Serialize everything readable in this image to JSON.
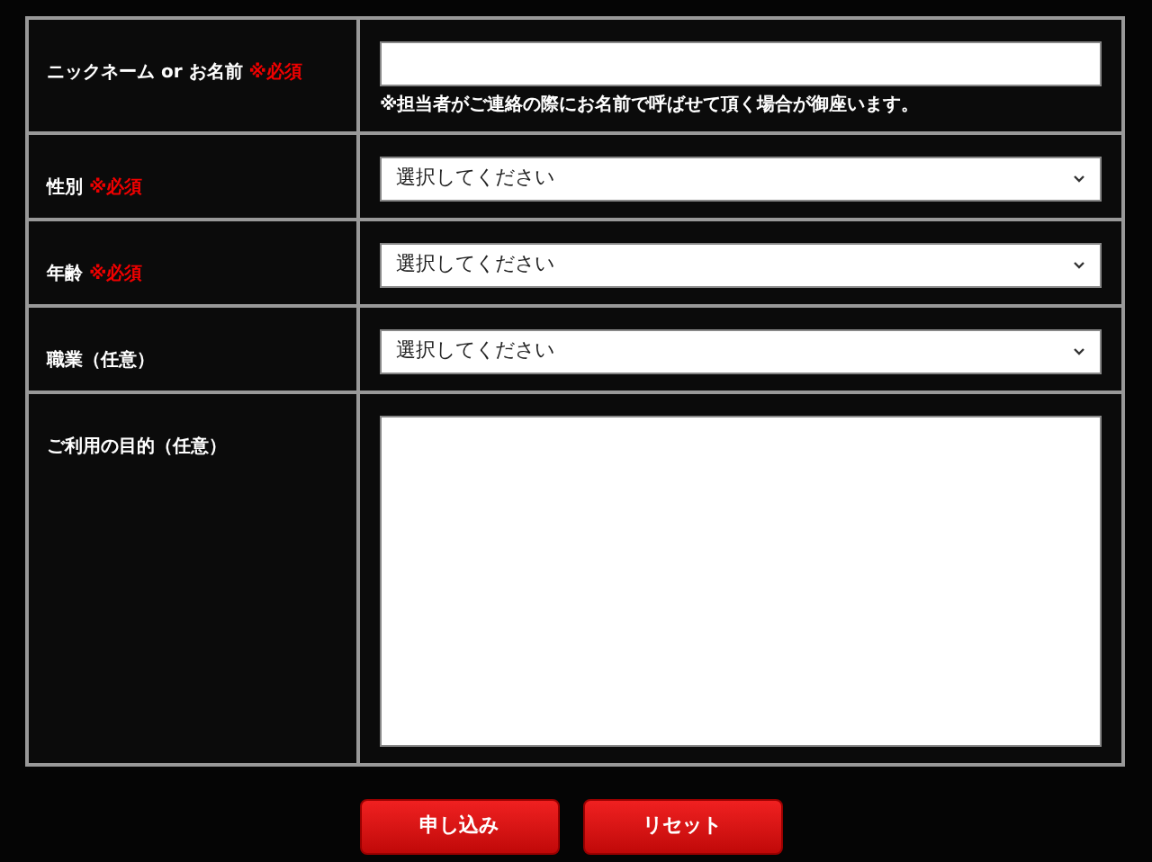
{
  "fields": [
    {
      "kind": "text",
      "label": "ニックネーム or お名前",
      "required": "※必須",
      "note": "※担当者がご連絡の際にお名前で呼ばせて頂く場合が御座います。"
    },
    {
      "kind": "select",
      "label": "性別",
      "required": "※必須",
      "placeholder": "選択してください"
    },
    {
      "kind": "select",
      "label": "年齢",
      "required": "※必須",
      "placeholder": "選択してください"
    },
    {
      "kind": "select",
      "label": "職業（任意）",
      "placeholder": "選択してください"
    },
    {
      "kind": "textarea",
      "label": "ご利用の目的（任意）"
    }
  ],
  "buttons": [
    "申し込み",
    "リセット"
  ]
}
